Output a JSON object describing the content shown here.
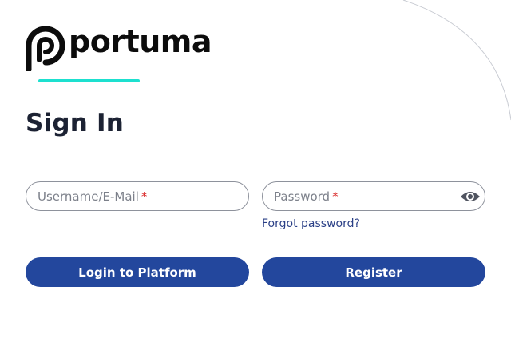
{
  "brand": {
    "name": "portuma",
    "accent_color": "#1de0cf",
    "primary_color": "#23479d"
  },
  "page": {
    "title": "Sign In"
  },
  "form": {
    "username_placeholder": "Username/E-Mail",
    "password_placeholder": "Password",
    "required_marker": "*",
    "show_password_icon": "eye-icon",
    "forgot_password_label": "Forgot password?",
    "login_label": "Login to Platform",
    "register_label": "Register"
  }
}
